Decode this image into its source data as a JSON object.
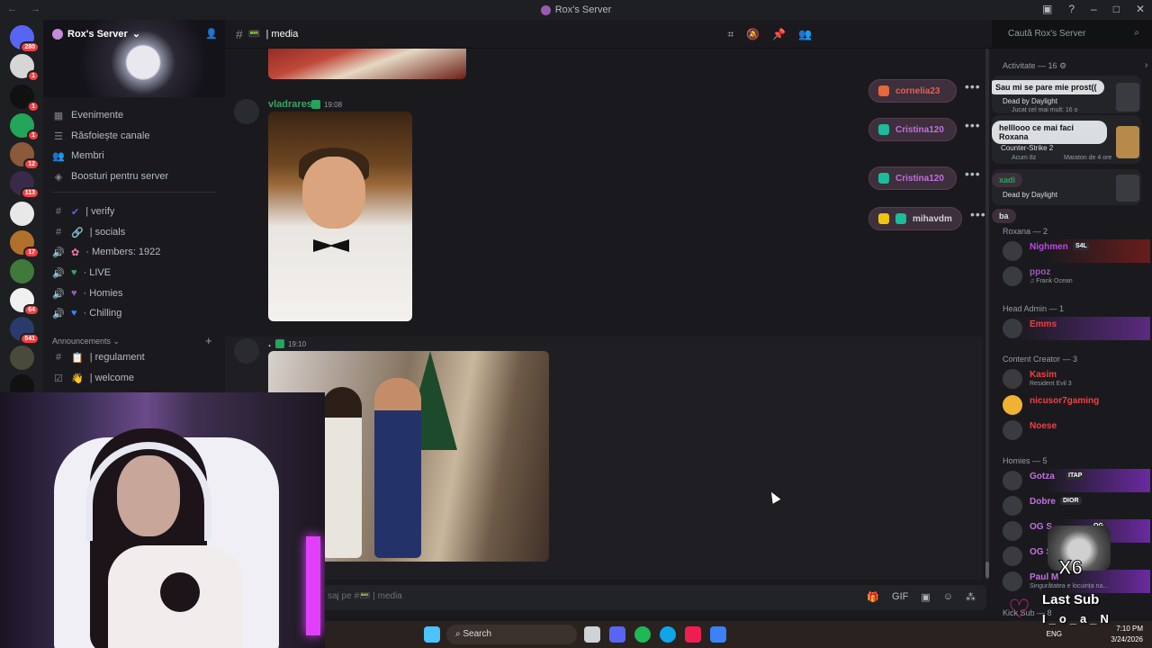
{
  "window": {
    "title": "Rox's Server",
    "nav_arrows": "← →"
  },
  "server": {
    "name": "Rox's Server",
    "menu": [
      {
        "icon": "calendar-icon",
        "label": "Evenimente"
      },
      {
        "icon": "browse-icon",
        "label": "Răsfoiește canale"
      },
      {
        "icon": "members-icon",
        "label": "Membri"
      },
      {
        "icon": "boost-icon",
        "label": "Boosturi pentru server"
      }
    ],
    "channels": [
      {
        "icon": "#",
        "emoji": "✔",
        "label": "| verify",
        "color": "#5865f2"
      },
      {
        "icon": "#",
        "emoji": "🔗",
        "label": "| socials",
        "color": "#b5bac1"
      },
      {
        "icon": "🔊",
        "emoji": "✿",
        "label": "· Members: 1922",
        "color": "#f47fa8"
      },
      {
        "icon": "🔊",
        "emoji": "♥",
        "label": "· LIVE",
        "color": "#3ba55d"
      },
      {
        "icon": "🔊",
        "emoji": "♥",
        "label": "· Homies",
        "color": "#9b59b6"
      },
      {
        "icon": "🔊",
        "emoji": "♥",
        "label": "· Chilling",
        "color": "#3b82f6"
      }
    ],
    "category": "Announcements",
    "announce_channels": [
      {
        "icon": "#",
        "emoji": "📋",
        "label": "| regulament"
      },
      {
        "icon": "☑",
        "emoji": "👋",
        "label": "| welcome"
      }
    ]
  },
  "rail_badges": [
    "280",
    "1",
    "1",
    "1",
    "12",
    "113",
    "17",
    "64",
    "541"
  ],
  "chat": {
    "channel": "| media",
    "search_placeholder": "Caută Rox's Server",
    "messages": [
      {
        "user": "vladrares",
        "time": "19:08",
        "user_color": "#3ba55d"
      },
      {
        "user": ".",
        "time": "19:10",
        "user_color": "#dbdee1"
      }
    ],
    "input_placeholder": "saj pe #📟 | media"
  },
  "reactions": [
    {
      "name": "cornelia23",
      "color": "#e85d54",
      "icon_color": "#e8673c"
    },
    {
      "name": "Cristina120",
      "color": "#c46fe0",
      "icon_color": "#1abc9c"
    },
    {
      "name": "Cristina120",
      "color": "#c46fe0",
      "icon_color": "#1abc9c"
    },
    {
      "name": "mihavdm",
      "color": "#cfd2d6",
      "icon_color": "#f1c40f"
    }
  ],
  "members": {
    "activity_label": "Activitate — 16",
    "activities": [
      {
        "bubble": "Sau mi se pare mie prost((",
        "game": "Dead by Daylight",
        "detail": "Jucat cel mai mult: 16 o"
      },
      {
        "bubble": "helllooo ce mai faci Roxana",
        "game": "Counter-Strike 2",
        "detail": "Acum 8z",
        "detail2": "Maraton de 4 ore"
      },
      {
        "bubble": "xadi",
        "game": "Dead by Daylight",
        "detail": ""
      },
      {
        "bubble": "ba",
        "game": "",
        "detail": ""
      }
    ],
    "groups": [
      {
        "label": "Roxana — 2",
        "members": [
          {
            "name": "Nighmen",
            "color": "#c046e6",
            "tag": "S4L",
            "sub": ""
          },
          {
            "name": "ppoz",
            "color": "#9b59b6",
            "tag": "",
            "sub": "♫ Frank Ocean"
          }
        ]
      },
      {
        "label": "Head Admin — 1",
        "members": [
          {
            "name": "Emms",
            "color": "#f23f43",
            "tag": "",
            "sub": ""
          }
        ]
      },
      {
        "label": "Content Creator — 3",
        "members": [
          {
            "name": "Kasim",
            "color": "#f23f43",
            "tag": "",
            "sub": "Resident Evil 3"
          },
          {
            "name": "nicusor7gaming",
            "color": "#f23f43",
            "tag": "",
            "sub": ""
          },
          {
            "name": "Noese",
            "color": "#f23f43",
            "tag": "",
            "sub": ""
          }
        ]
      },
      {
        "label": "Homies — 5",
        "members": [
          {
            "name": "Gotza",
            "color": "#c46fe0",
            "tag": "ITAP",
            "sub": ""
          },
          {
            "name": "Dobre",
            "color": "#c46fe0",
            "tag": "DIOR",
            "sub": ""
          },
          {
            "name": "OG S",
            "color": "#c46fe0",
            "tag": "OG",
            "sub": ""
          },
          {
            "name": "OG S",
            "color": "#c46fe0",
            "tag": "OG",
            "sub": ""
          },
          {
            "name": "Paul M",
            "color": "#c46fe0",
            "tag": "",
            "sub": "Singurătatea e locuința na..."
          }
        ]
      }
    ],
    "kick_label": "Kick Sub — 8"
  },
  "overlay": {
    "multiplier": "X6",
    "last_sub_label": "Last Sub",
    "last_sub_name": "I_o_a_N"
  },
  "taskbar": {
    "search": "Search",
    "lang": "ENG",
    "time": "7:10 PM",
    "date": "3/24/2026"
  }
}
